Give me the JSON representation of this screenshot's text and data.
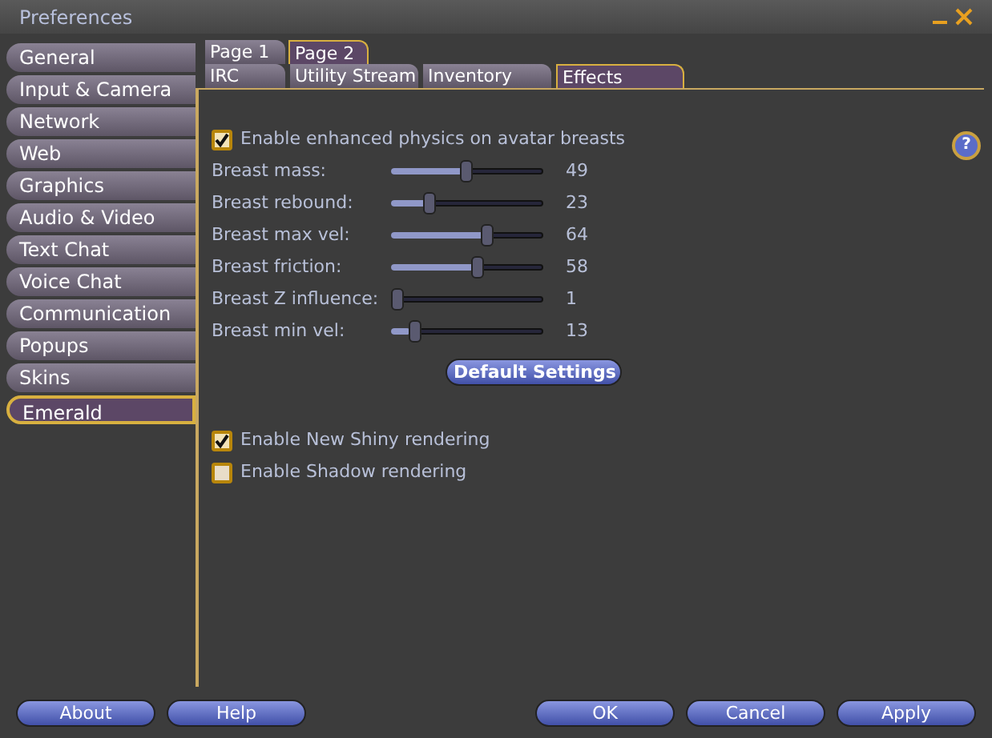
{
  "window": {
    "title": "Preferences"
  },
  "sidebar": {
    "items": [
      {
        "label": "General",
        "selected": false
      },
      {
        "label": "Input & Camera",
        "selected": false
      },
      {
        "label": "Network",
        "selected": false
      },
      {
        "label": "Web",
        "selected": false
      },
      {
        "label": "Graphics",
        "selected": false
      },
      {
        "label": "Audio & Video",
        "selected": false
      },
      {
        "label": "Text Chat",
        "selected": false
      },
      {
        "label": "Voice Chat",
        "selected": false
      },
      {
        "label": "Communication",
        "selected": false
      },
      {
        "label": "Popups",
        "selected": false
      },
      {
        "label": "Skins",
        "selected": false
      },
      {
        "label": "Emerald",
        "selected": true
      }
    ]
  },
  "page_tabs": [
    {
      "label": "Page 1",
      "selected": false
    },
    {
      "label": "Page 2",
      "selected": true
    }
  ],
  "tabs": [
    {
      "label": "IRC",
      "selected": false
    },
    {
      "label": "Utility Stream",
      "selected": false
    },
    {
      "label": "Inventory",
      "selected": false
    },
    {
      "label": "Effects",
      "selected": true
    }
  ],
  "physics": {
    "label": "Enable enhanced physics on avatar breasts",
    "checked": true
  },
  "help_button": "?",
  "sliders": [
    {
      "label": "Breast mass:",
      "level": 0.49,
      "reading": "49"
    },
    {
      "label": "Breast rebound:",
      "level": 0.23,
      "reading": "23"
    },
    {
      "label": "Breast max vel:",
      "level": 0.64,
      "reading": "64"
    },
    {
      "label": "Breast friction:",
      "level": 0.58,
      "reading": "58"
    },
    {
      "label": "Breast Z influence:",
      "level": 0.0,
      "reading": "1"
    },
    {
      "label": "Breast min vel:",
      "level": 0.13,
      "reading": "13"
    }
  ],
  "default_button": "Default Settings",
  "render_options": [
    {
      "label": "Enable New Shiny rendering",
      "checked": true
    },
    {
      "label": "Enable Shadow rendering",
      "checked": false
    }
  ],
  "buttons_left": [
    "About",
    "Help"
  ],
  "buttons_right": [
    "OK",
    "Cancel",
    "Apply"
  ]
}
